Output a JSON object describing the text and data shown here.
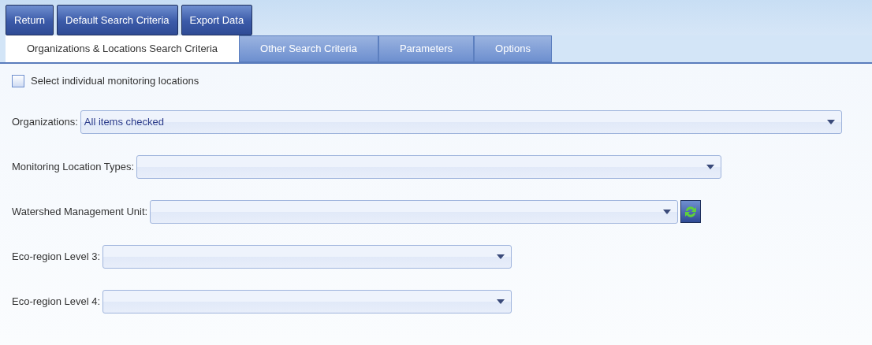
{
  "toolbar": {
    "buttons": [
      "Return",
      "Default Search Criteria",
      "Export Data"
    ]
  },
  "tabs": [
    {
      "label": "Organizations & Locations Search Criteria",
      "selected": true
    },
    {
      "label": "Other Search Criteria",
      "selected": false
    },
    {
      "label": "Parameters",
      "selected": false
    },
    {
      "label": "Options",
      "selected": false
    }
  ],
  "checkbox": {
    "label": "Select individual monitoring locations",
    "checked": false
  },
  "fields": [
    {
      "label": "Organizations:",
      "value": "All items checked",
      "refresh_button": false
    },
    {
      "label": "Monitoring Location Types:",
      "refresh_button": false
    },
    {
      "label": "Watershed Management Unit:",
      "refresh_button": true
    },
    {
      "label": "Eco-region Level 3:",
      "refresh_button": false
    },
    {
      "label": "Eco-region Level 4:",
      "refresh_button": false
    }
  ]
}
